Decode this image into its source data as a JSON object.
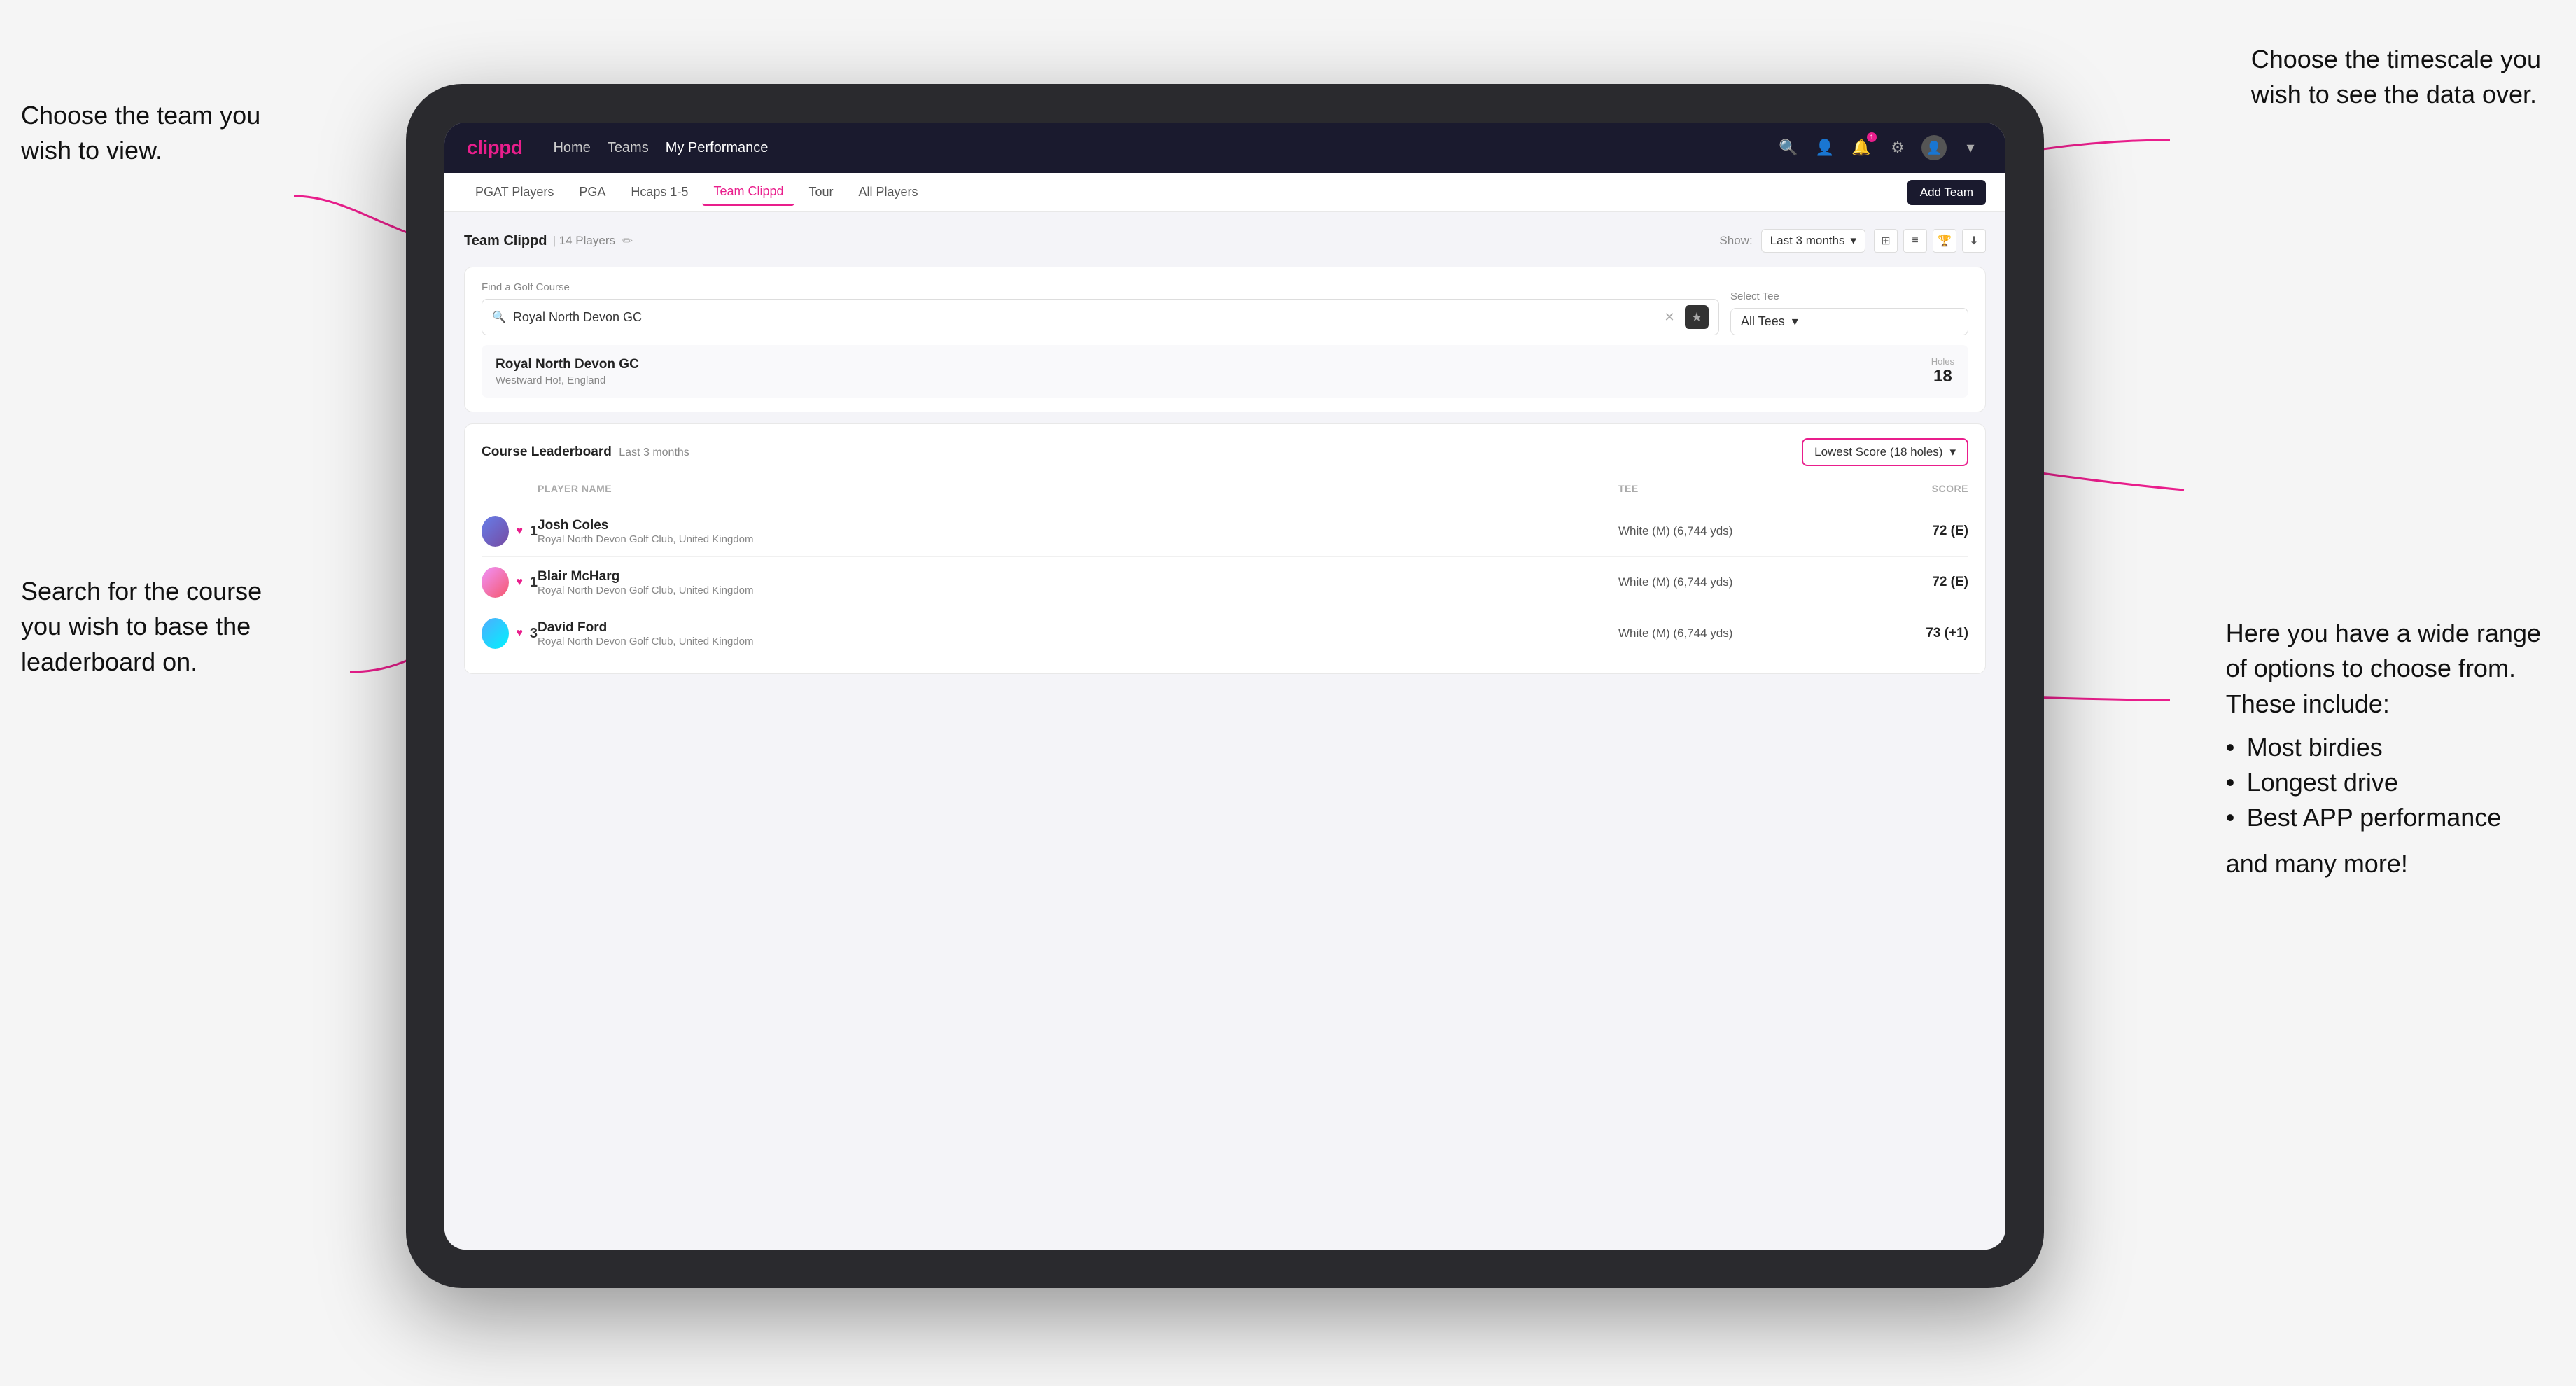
{
  "annotations": {
    "top_left": {
      "line1": "Choose the team you",
      "line2": "wish to view."
    },
    "top_right": {
      "line1": "Choose the timescale you",
      "line2": "wish to see the data over."
    },
    "bottom_left": {
      "line1": "Search for the course",
      "line2": "you wish to base the",
      "line3": "leaderboard on."
    },
    "bottom_right": {
      "title": "Here you have a wide range",
      "title2": "of options to choose from.",
      "title3": "These include:",
      "bullets": [
        "Most birdies",
        "Longest drive",
        "Best APP performance"
      ],
      "footer": "and many more!"
    }
  },
  "nav": {
    "logo": "clippd",
    "links": [
      "Home",
      "Teams",
      "My Performance"
    ],
    "active_link": "My Performance"
  },
  "sub_nav": {
    "items": [
      "PGAT Players",
      "PGA",
      "Hcaps 1-5",
      "Team Clippd",
      "Tour",
      "All Players"
    ],
    "active": "Team Clippd",
    "add_button": "Add Team"
  },
  "team_header": {
    "team_name": "Team Clippd",
    "player_count": "14 Players",
    "show_label": "Show:",
    "show_value": "Last 3 months"
  },
  "search": {
    "find_label": "Find a Golf Course",
    "find_placeholder": "Royal North Devon GC",
    "find_value": "Royal North Devon GC",
    "tee_label": "Select Tee",
    "tee_value": "All Tees"
  },
  "course_result": {
    "name": "Royal North Devon GC",
    "location": "Westward Ho!, England",
    "holes_label": "Holes",
    "holes_value": "18"
  },
  "leaderboard": {
    "title": "Course Leaderboard",
    "subtitle": "Last 3 months",
    "score_option": "Lowest Score (18 holes)",
    "columns": [
      "PLAYER NAME",
      "TEE",
      "SCORE"
    ],
    "rows": [
      {
        "rank": "1",
        "name": "Josh Coles",
        "club": "Royal North Devon Golf Club, United Kingdom",
        "tee": "White (M) (6,744 yds)",
        "score": "72 (E)"
      },
      {
        "rank": "1",
        "name": "Blair McHarg",
        "club": "Royal North Devon Golf Club, United Kingdom",
        "tee": "White (M) (6,744 yds)",
        "score": "72 (E)"
      },
      {
        "rank": "3",
        "name": "David Ford",
        "club": "Royal North Devon Golf Club, United Kingdom",
        "tee": "White (M) (6,744 yds)",
        "score": "73 (+1)"
      }
    ]
  },
  "icons": {
    "search": "🔍",
    "person": "👤",
    "bell": "🔔",
    "settings": "⚙",
    "avatar": "👤",
    "edit": "✏",
    "grid": "⊞",
    "list": "≡",
    "trophy": "🏆",
    "download": "⬇",
    "star": "★",
    "heart": "♥",
    "chevron": "▾",
    "close": "✕"
  },
  "colors": {
    "brand_pink": "#e91e8c",
    "nav_dark": "#1a1a2e",
    "accent": "#e91e8c"
  }
}
